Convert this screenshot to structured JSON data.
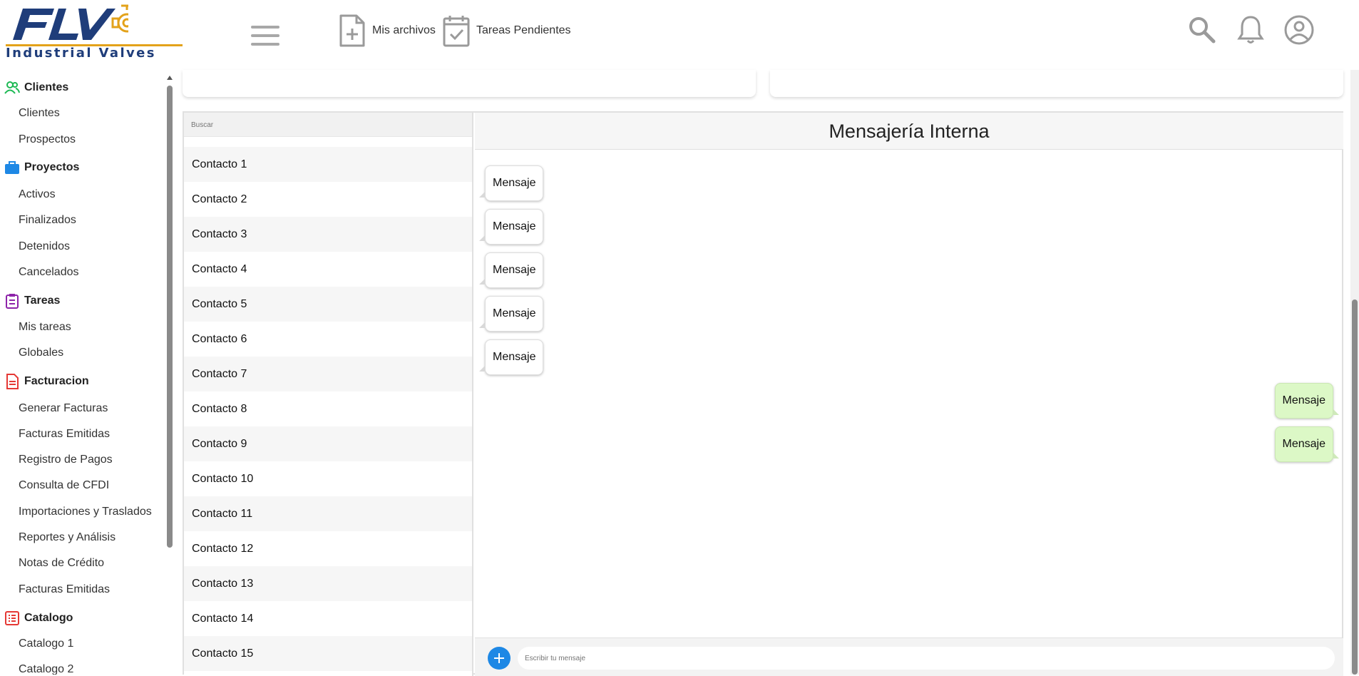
{
  "header": {
    "logo_text": "Industrial Valves",
    "logo_letters": "FLV",
    "links": [
      {
        "label": "Mis archivos",
        "icon": "file-add-icon"
      },
      {
        "label": "Tareas Pendientes",
        "icon": "clipboard-check-icon"
      }
    ],
    "icons": [
      "search-icon",
      "bell-icon",
      "user-circle-icon"
    ]
  },
  "sidebar": {
    "sections": [
      {
        "label": "Clientes",
        "icon": "users-icon",
        "color": "#1db954",
        "items": [
          "Clientes",
          "Prospectos"
        ]
      },
      {
        "label": "Proyectos",
        "icon": "briefcase-icon",
        "color": "#1e88e5",
        "items": [
          "Activos",
          "Finalizados",
          "Detenidos",
          "Cancelados"
        ]
      },
      {
        "label": "Tareas",
        "icon": "clipboard-icon",
        "color": "#8e24aa",
        "items": [
          "Mis tareas",
          "Globales"
        ]
      },
      {
        "label": "Facturacion",
        "icon": "document-icon",
        "color": "#e53935",
        "items": [
          "Generar Facturas",
          "Facturas Emitidas",
          "Registro de Pagos",
          "Consulta de CFDI",
          "Importaciones y Traslados",
          "Reportes y Análisis",
          "Notas de Crédito",
          "Facturas Emitidas"
        ]
      },
      {
        "label": "Catalogo",
        "icon": "list-icon",
        "color": "#e53935",
        "items": [
          "Catalogo 1",
          "Catalogo 2"
        ]
      }
    ]
  },
  "contacts": {
    "search_placeholder": "Buscar",
    "items": [
      "Contacto 1",
      "Contacto 2",
      "Contacto 3",
      "Contacto 4",
      "Contacto 5",
      "Contacto 6",
      "Contacto 7",
      "Contacto 8",
      "Contacto 9",
      "Contacto 10",
      "Contacto 11",
      "Contacto 12",
      "Contacto 13",
      "Contacto 14",
      "Contacto 15"
    ]
  },
  "chat": {
    "title": "Mensajería Interna",
    "messages": [
      {
        "text": "Mensaje",
        "direction": "in"
      },
      {
        "text": "Mensaje",
        "direction": "in"
      },
      {
        "text": "Mensaje",
        "direction": "in"
      },
      {
        "text": "Mensaje",
        "direction": "in"
      },
      {
        "text": "Mensaje",
        "direction": "in"
      },
      {
        "text": "Mensaje",
        "direction": "out"
      },
      {
        "text": "Mensaje",
        "direction": "out"
      }
    ],
    "input_placeholder": "Escribir tu mensaje"
  },
  "colors": {
    "brand_blue": "#1f3d7a",
    "brand_gold": "#e3a21a",
    "accent_blue": "#1e88e5",
    "outgoing_bubble": "#dcf8c6"
  }
}
